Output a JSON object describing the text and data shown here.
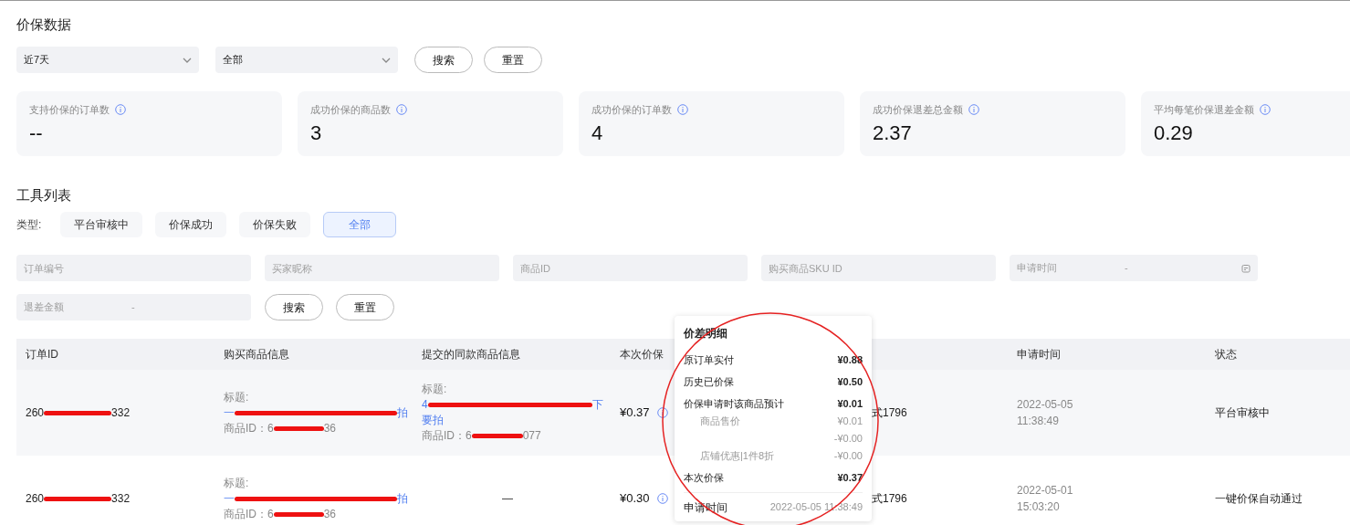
{
  "page_title": "价保数据",
  "filters": [
    {
      "value": "近7天"
    },
    {
      "value": "全部"
    }
  ],
  "filter_buttons": [
    "搜索",
    "重置"
  ],
  "stats": [
    {
      "label": "支持价保的订单数",
      "value": "--"
    },
    {
      "label": "成功价保的商品数",
      "value": "3"
    },
    {
      "label": "成功价保的订单数",
      "value": "4"
    },
    {
      "label": "成功价保退差总金额",
      "value": "2.37"
    },
    {
      "label": "平均每笔价保退差金额",
      "value": "0.29"
    }
  ],
  "tool_list": {
    "title": "工具列表",
    "type_label": "类型:",
    "type_tabs": [
      {
        "label": "平台审核中",
        "selected": false
      },
      {
        "label": "价保成功",
        "selected": false
      },
      {
        "label": "价保失败",
        "selected": false
      },
      {
        "label": "全部",
        "selected": true
      }
    ],
    "fields": [
      {
        "kind": "text",
        "placeholder": "订单编号"
      },
      {
        "kind": "text",
        "placeholder": "买家昵称"
      },
      {
        "kind": "text",
        "placeholder": "商品ID"
      },
      {
        "kind": "text",
        "placeholder": "购买商品SKU ID"
      },
      {
        "kind": "date",
        "placeholder": "申请时间",
        "separator": "-"
      }
    ],
    "amount_range": {
      "placeholder": "退差金额",
      "separator": "-"
    },
    "buttons": [
      "搜索",
      "重置"
    ]
  },
  "table": {
    "columns": [
      "订单ID",
      "购买商品信息",
      "提交的同款商品信息",
      "本次价保",
      "申请时间",
      "状态"
    ],
    "rows": [
      {
        "order_id": [
          {
            "kind": "text",
            "text": "260"
          },
          {
            "kind": "redacted"
          },
          {
            "kind": "text",
            "text": "332"
          }
        ],
        "purchased": {
          "title_label": "标题:",
          "title": [
            {
              "kind": "text",
              "text": "一"
            },
            {
              "kind": "redacted"
            },
            {
              "kind": "text",
              "text": "拍"
            }
          ],
          "id": [
            {
              "kind": "text",
              "text": "商品ID：6"
            },
            {
              "kind": "redacted"
            },
            {
              "kind": "text",
              "text": "36"
            }
          ]
        },
        "submitted": {
          "kind": "info",
          "title_label": "标题:",
          "title": [
            {
              "kind": "text",
              "text": "4"
            },
            {
              "kind": "redacted"
            },
            {
              "kind": "text",
              "text": "下"
            }
          ],
          "title_line2": "要拍",
          "id": [
            {
              "kind": "text",
              "text": "商品ID：6"
            },
            {
              "kind": "redacted"
            },
            {
              "kind": "text",
              "text": "077"
            }
          ]
        },
        "price": "¥0.37",
        "column_5": "式1796",
        "date": "2022-05-05",
        "time": "11:38:49",
        "status": "平台审核中"
      },
      {
        "order_id": [
          {
            "kind": "text",
            "text": "260"
          },
          {
            "kind": "redacted"
          },
          {
            "kind": "text",
            "text": "332"
          }
        ],
        "purchased": {
          "title_label": "标题:",
          "title": [
            {
              "kind": "text",
              "text": "一"
            },
            {
              "kind": "redacted"
            },
            {
              "kind": "text",
              "text": "拍"
            }
          ],
          "id": [
            {
              "kind": "text",
              "text": "商品ID：6"
            },
            {
              "kind": "redacted"
            },
            {
              "kind": "text",
              "text": "36"
            }
          ]
        },
        "submitted": {
          "kind": "empty",
          "text": "—"
        },
        "price": "¥0.30",
        "column_5": "式1796",
        "date": "2022-05-01",
        "time": "15:03:20",
        "status": "一键价保自动通过"
      }
    ]
  },
  "popover": {
    "title": "价差明细",
    "rows": [
      {
        "kind": "main",
        "label": "原订单实付",
        "value": "¥0.88"
      },
      {
        "kind": "main",
        "label": "历史已价保",
        "value": "¥0.50"
      },
      {
        "kind": "main",
        "label": "价保申请时该商品预计",
        "value": "¥0.01"
      },
      {
        "kind": "sub",
        "label": "商品售价",
        "value": "¥0.01"
      },
      {
        "kind": "sub",
        "value": "-¥0.00"
      },
      {
        "kind": "sub",
        "label": "店铺优惠|1件8折",
        "value": "-¥0.00"
      },
      {
        "kind": "main",
        "label": "本次价保",
        "value": "¥0.37"
      }
    ],
    "footer_label": "申请时间",
    "footer_value": "2022-05-05 11:38:49"
  }
}
